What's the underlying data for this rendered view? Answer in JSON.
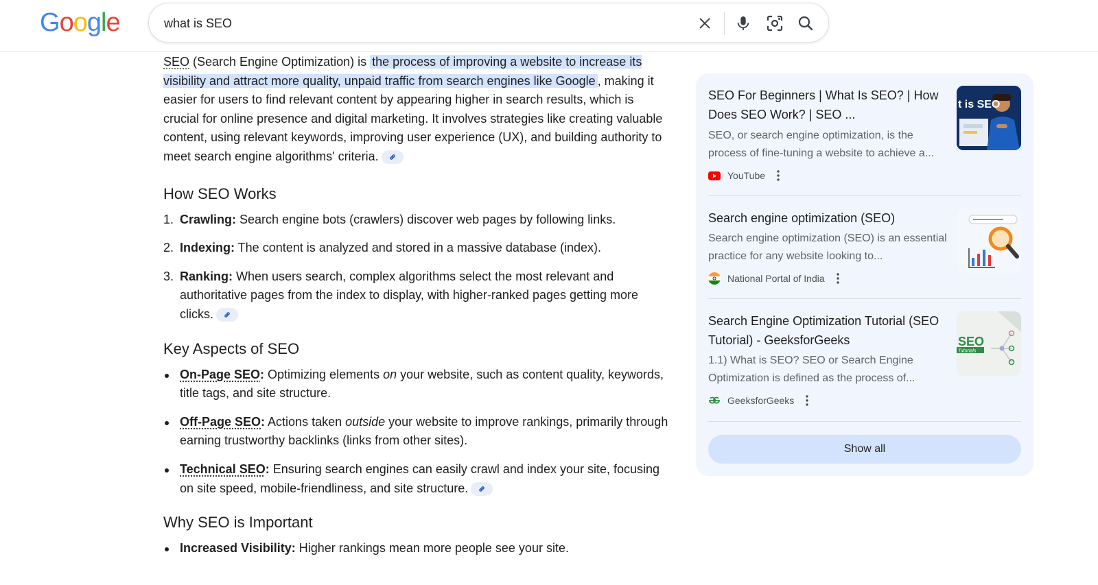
{
  "header": {
    "logo_letters": [
      "G",
      "o",
      "o",
      "g",
      "l",
      "e"
    ],
    "query": "what is SEO",
    "icons": [
      "close-icon",
      "microphone-icon",
      "lens-icon",
      "search-icon"
    ]
  },
  "answer": {
    "intro": {
      "term": "SEO",
      "pre": " (Search Engine Optimization) is ",
      "highlight": "the process of improving a website to increase its visibility and attract more quality, unpaid traffic from search engines like Google",
      "post": ", making it easier for users to find relevant content by appearing higher in search results, which is crucial for online presence and digital marketing. It involves strategies like creating valuable content, using relevant keywords, improving user experience (UX), and building authority to meet search engine algorithms' criteria."
    },
    "how_heading": "How SEO Works",
    "steps": [
      {
        "num": "1.",
        "term": "Crawling:",
        "text": " Search engine bots (crawlers) discover web pages by following links."
      },
      {
        "num": "2.",
        "term": "Indexing:",
        "text": " The content is analyzed and stored in a massive database (index)."
      },
      {
        "num": "3.",
        "term": "Ranking:",
        "text": " When users search, complex algorithms select the most relevant and authoritative pages from the index to display, with higher-ranked pages getting more clicks."
      }
    ],
    "aspects_heading": "Key Aspects of SEO",
    "aspects": [
      {
        "term": "On-Page SEO",
        "colon": ":",
        "pre": " Optimizing elements ",
        "em": "on",
        "post": " your website, such as content quality, keywords, title tags, and site structure."
      },
      {
        "term": "Off-Page SEO",
        "colon": ":",
        "pre": " Actions taken ",
        "em": "outside",
        "post": " your website to improve rankings, primarily through earning trustworthy backlinks (links from other sites)."
      },
      {
        "term": "Technical SEO",
        "colon": ":",
        "pre": " Ensuring search engines can easily crawl and index your site, focusing on site speed, mobile-friendliness, and site structure.",
        "em": "",
        "post": ""
      }
    ],
    "why_heading": "Why SEO is Important",
    "why": [
      {
        "term": "Increased Visibility:",
        "text": " Higher rankings mean more people see your site."
      }
    ]
  },
  "sources": {
    "cards": [
      {
        "title": "SEO For Beginners | What Is SEO? | How Does SEO Work? | SEO ...",
        "snippet": "SEO, or search engine optimization, is the process of fine-tuning a website to achieve a...",
        "source": "YouTube",
        "source_icon": "youtube-icon",
        "thumb_text": "t is SEO"
      },
      {
        "title": "Search engine optimization (SEO)",
        "snippet": "Search engine optimization (SEO) is an essential practice for any website looking to...",
        "source": "National Portal of India",
        "source_icon": "india-flag-icon",
        "thumb_text": ""
      },
      {
        "title": "Search Engine Optimization Tutorial (SEO Tutorial) - GeeksforGeeks",
        "snippet": "1.1) What is SEO? SEO or Search Engine Optimization is defined as the process of...",
        "source": "GeeksforGeeks",
        "source_icon": "geeksforgeeks-icon",
        "thumb_text": "SEO",
        "thumb_sub": "Tutorials"
      }
    ],
    "show_all": "Show all"
  },
  "colors": {
    "highlight": "#d3e3fd",
    "panel_bg": "#f1f5fd",
    "show_all_bg": "#d3e3fd",
    "text": "#1f1f1f",
    "muted": "#5f6368"
  }
}
